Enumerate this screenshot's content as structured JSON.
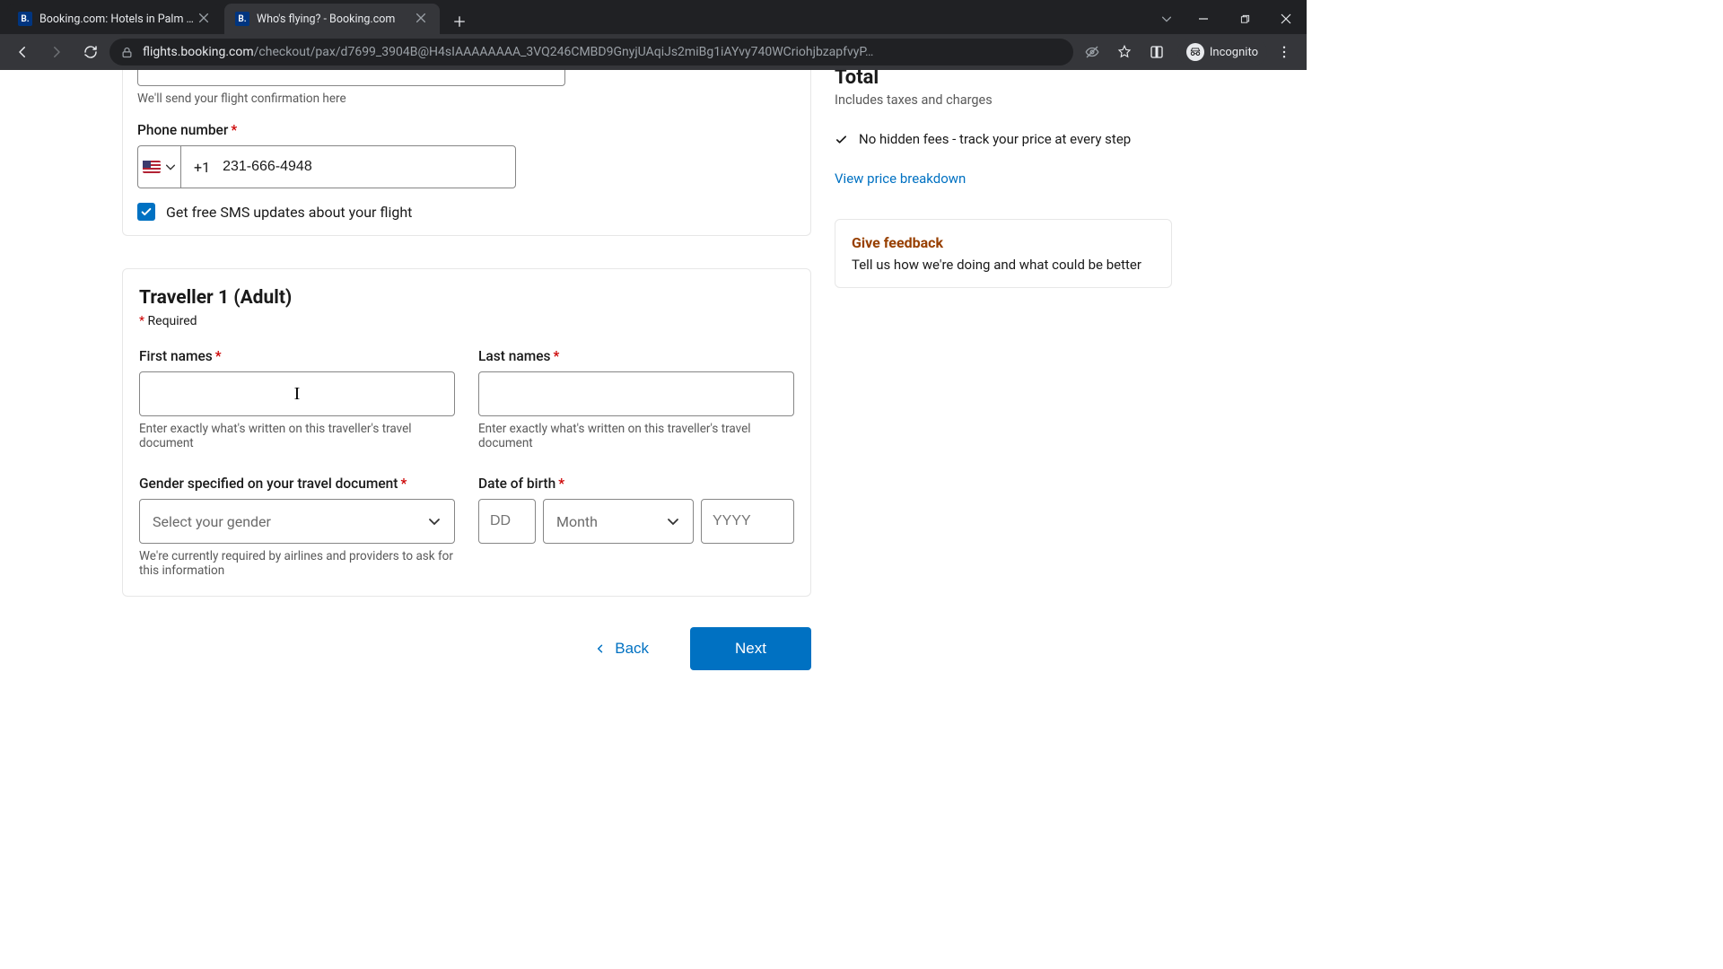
{
  "browser": {
    "tabs": [
      {
        "title": "Booking.com: Hotels in Palm Sp",
        "favicon": "B."
      },
      {
        "title": "Who's flying? - Booking.com",
        "favicon": "B."
      }
    ],
    "url_domain": "flights.booking.com",
    "url_path": "/checkout/pax/d7699_3904B@H4sIAAAAAAAA_3VQ246CMBD9GnyjUAqiJs2miBg1iAYvy740WCriohjbzapfvyP…",
    "incognito_label": "Incognito"
  },
  "contact": {
    "email_hint": "We'll send your flight confirmation here",
    "phone_label": "Phone number",
    "country_code": "+1",
    "phone_value": "231-666-4948",
    "sms_label": "Get free SMS updates about your flight",
    "sms_checked": true
  },
  "traveller": {
    "title": "Traveller 1 (Adult)",
    "required_note": "Required",
    "first_names_label": "First names",
    "last_names_label": "Last names",
    "name_hint": "Enter exactly what's written on this traveller's travel document",
    "gender_label": "Gender specified on your travel document",
    "gender_placeholder": "Select your gender",
    "gender_hint": "We're currently required by airlines and providers to ask for this information",
    "dob_label": "Date of birth",
    "dob_dd_placeholder": "DD",
    "dob_mm_placeholder": "Month",
    "dob_yy_placeholder": "YYYY"
  },
  "nav": {
    "back": "Back",
    "next": "Next"
  },
  "side": {
    "total_label": "Total",
    "total_sub": "Includes taxes and charges",
    "no_hidden": "No hidden fees - track your price at every step",
    "view_link": "View price breakdown",
    "feedback_title": "Give feedback",
    "feedback_sub": "Tell us how we're doing and what could be better"
  }
}
